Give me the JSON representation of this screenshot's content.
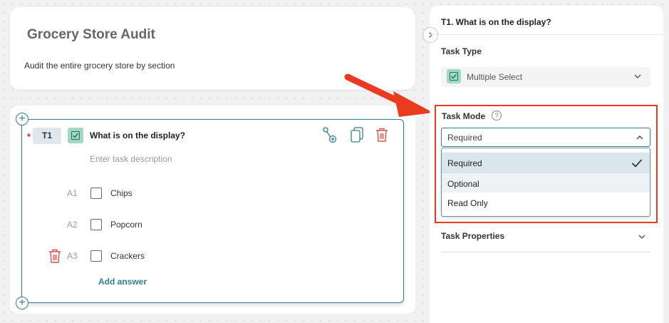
{
  "header": {
    "title": "Grocery Store Audit",
    "description": "Audit the entire grocery store by section"
  },
  "task": {
    "id": "T1",
    "required_marker": "*",
    "title": "What is on the display?",
    "description_placeholder": "Enter task description",
    "answers": [
      {
        "id": "A1",
        "label": "Chips"
      },
      {
        "id": "A2",
        "label": "Popcorn"
      },
      {
        "id": "A3",
        "label": "Crackers"
      }
    ],
    "add_answer_label": "Add answer",
    "icons": [
      "branch-logic-icon",
      "copy-icon",
      "trash-icon"
    ]
  },
  "panel": {
    "title": "T1. What is on the display?",
    "task_type_label": "Task Type",
    "task_type_value": "Multiple Select",
    "task_mode_label": "Task Mode",
    "help_glyph": "?",
    "task_mode_value": "Required",
    "task_mode_options": [
      "Required",
      "Optional",
      "Read Only"
    ],
    "task_properties_label": "Task Properties"
  },
  "colors": {
    "accent": "#2f7e91",
    "type_icon_bg": "#9fd9c4",
    "danger": "#d9534f",
    "highlight_frame": "#ea3b20",
    "selected_option_bg": "#d9e6ec"
  }
}
